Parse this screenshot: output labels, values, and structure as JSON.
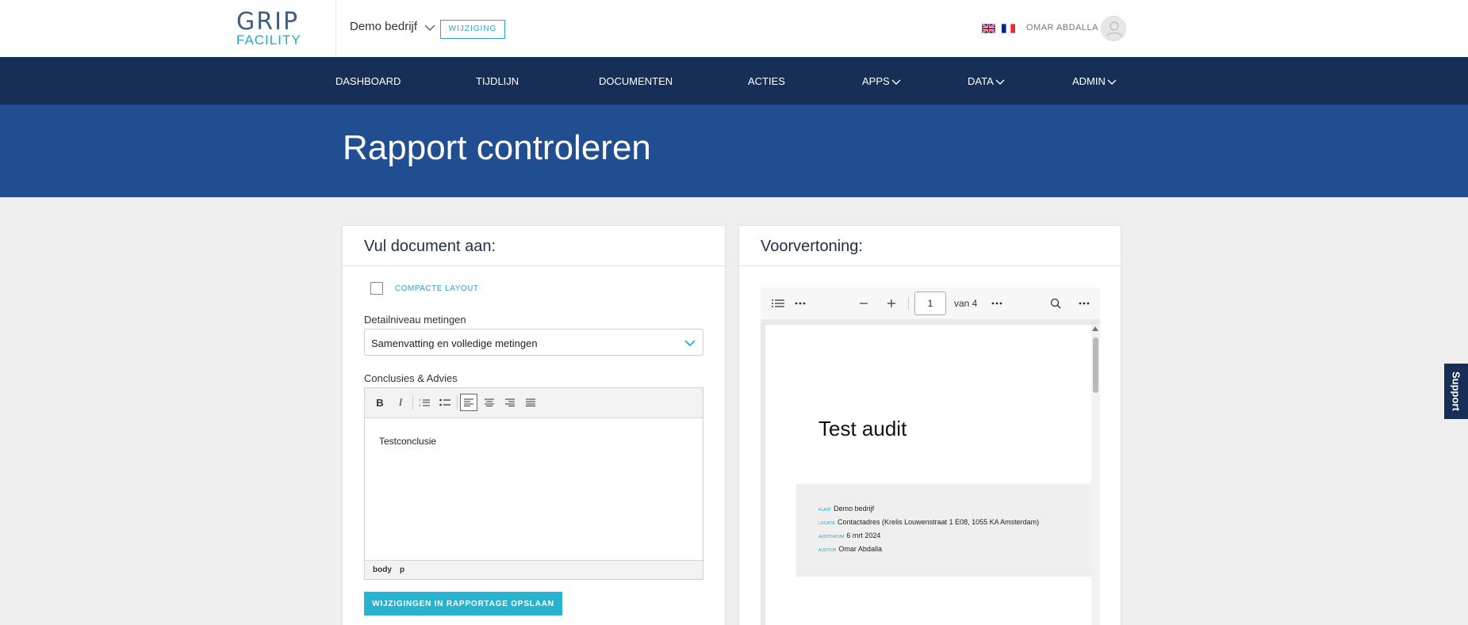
{
  "header": {
    "logo_top": "GRIP",
    "logo_bottom": "FACILITY",
    "company": "Demo bedrijf",
    "change_button": "WIJZIGING",
    "languages": [
      "en-flag-icon",
      "fr-flag-icon"
    ],
    "user_name": "OMAR ABDALLA"
  },
  "nav": {
    "items": [
      {
        "label": "DASHBOARD",
        "dropdown": false
      },
      {
        "label": "TIJDLIJN",
        "dropdown": false
      },
      {
        "label": "DOCUMENTEN",
        "dropdown": false
      },
      {
        "label": "ACTIES",
        "dropdown": false
      },
      {
        "label": "APPS",
        "dropdown": true
      },
      {
        "label": "DATA",
        "dropdown": true
      },
      {
        "label": "ADMIN",
        "dropdown": true
      }
    ]
  },
  "page": {
    "title": "Rapport controleren"
  },
  "form": {
    "title": "Vul document aan:",
    "compact_layout_label": "COMPACTE LAYOUT",
    "compact_layout_checked": false,
    "detail_label": "Detailniveau metingen",
    "detail_value": "Samenvatting en volledige metingen",
    "conclusion_label": "Conclusies & Advies",
    "toolbar": {
      "bold": "B",
      "italic": "I"
    },
    "editor_content": "Testconclusie",
    "status_path": [
      "body",
      "p"
    ],
    "save_button": "WIJZIGINGEN IN RAPPORTAGE OPSLAAN"
  },
  "preview": {
    "title": "Voorvertoning:",
    "page_number": "1",
    "page_total": "van 4",
    "doc_title": "Test audit",
    "info": [
      {
        "key": "Klant",
        "value": "Demo bedrijf"
      },
      {
        "key": "Locatie",
        "value": "Contactadres (Krelis Louwenstraat 1 E08, 1055 KA Amsterdam)"
      },
      {
        "key": "Auditdatum",
        "value": "6 mrt 2024"
      },
      {
        "key": "Auditor",
        "value": "Omar Abdalla"
      }
    ]
  },
  "support_tab": "Support",
  "colors": {
    "navbar": "#172f57",
    "hero": "#214e91",
    "accent": "#28a5c7",
    "save_button": "#28b3cf"
  }
}
